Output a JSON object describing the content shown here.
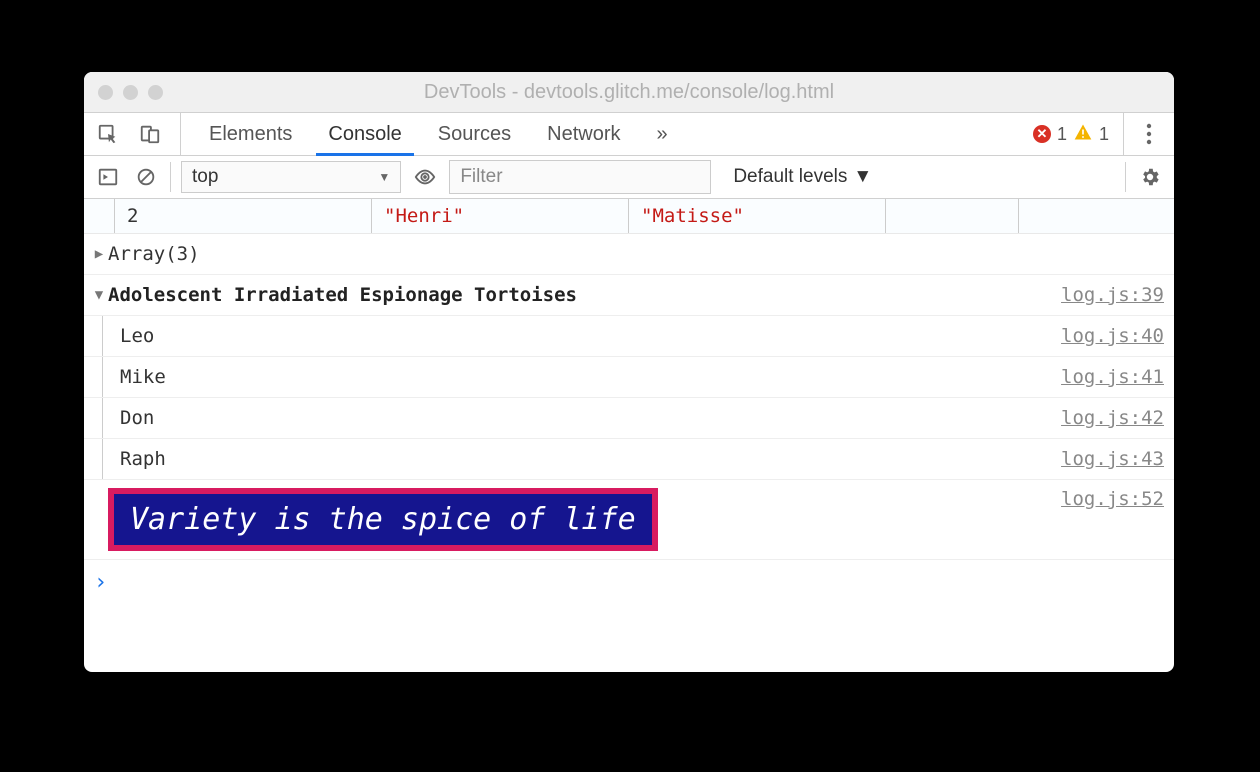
{
  "window": {
    "title": "DevTools - devtools.glitch.me/console/log.html"
  },
  "tabs": {
    "items": [
      "Elements",
      "Console",
      "Sources",
      "Network"
    ],
    "active": "Console",
    "overflow": "»"
  },
  "errors": {
    "count": "1"
  },
  "warnings": {
    "count": "1"
  },
  "toolbar": {
    "context": "top",
    "filter_placeholder": "Filter",
    "levels": "Default levels"
  },
  "table": {
    "index": "2",
    "col1": "\"Henri\"",
    "col2": "\"Matisse\""
  },
  "array_line": "Array(3)",
  "group": {
    "title": "Adolescent Irradiated Espionage Tortoises",
    "source": "log.js:39",
    "items": [
      {
        "label": "Leo",
        "source": "log.js:40"
      },
      {
        "label": "Mike",
        "source": "log.js:41"
      },
      {
        "label": "Don",
        "source": "log.js:42"
      },
      {
        "label": "Raph",
        "source": "log.js:43"
      }
    ]
  },
  "styled": {
    "text": "Variety is the spice of life",
    "source": "log.js:52",
    "colors": {
      "bg": "#15158f",
      "border": "#d81b60",
      "text": "#ffffff"
    }
  },
  "prompt": "›"
}
